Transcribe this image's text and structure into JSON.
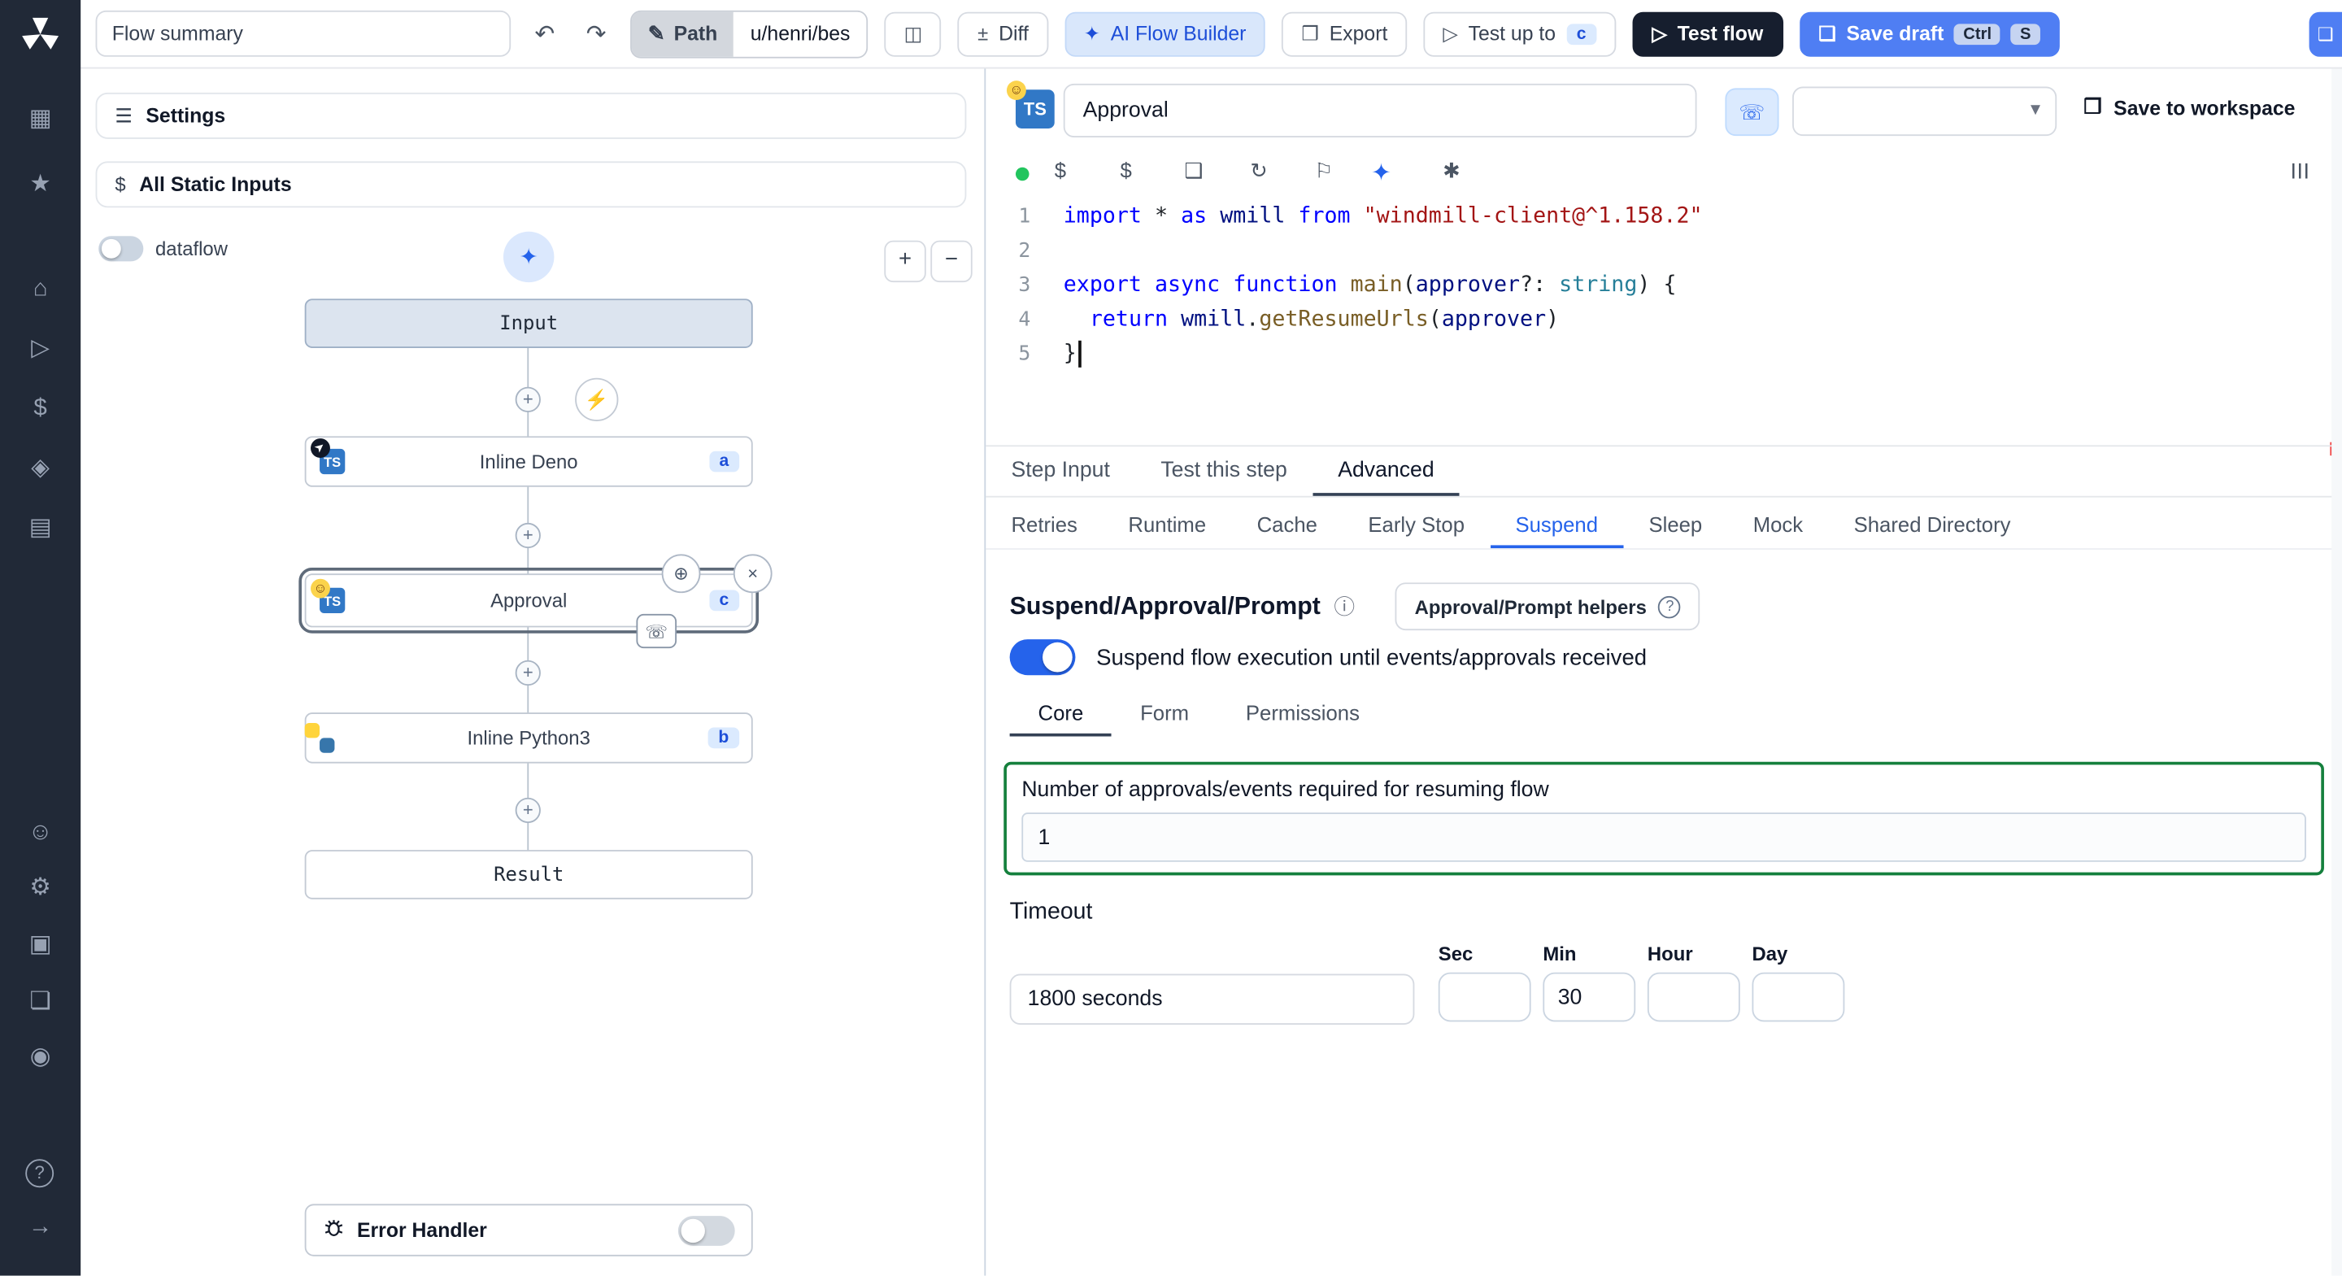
{
  "topbar": {
    "flow_summary_value": "Flow summary",
    "undo_icon": "↶",
    "redo_icon": "↷",
    "pencil_icon": "✎",
    "path_label": "Path",
    "path_value": "u/henri/bes",
    "book_icon": "◫",
    "diff_icon": "±",
    "diff_label": "Diff",
    "ai_icon": "✦",
    "ai_flow_builder_label": "AI Flow Builder",
    "export_icon": "❒",
    "export_label": "Export",
    "play_icon": "▷",
    "test_up_to_label": "Test up to",
    "test_up_to_badge": "c",
    "test_flow_label": "Test flow",
    "save_icon": "❑",
    "save_draft_label": "Save draft",
    "kbd_ctrl": "Ctrl",
    "kbd_s": "S",
    "partial_icon": "❑"
  },
  "sidebar": {
    "icons": [
      "▦",
      "★",
      "⌂",
      "▷",
      "$",
      "◈",
      "▤",
      "☺",
      "⚙",
      "▣",
      "❏",
      "◉",
      "?",
      "→"
    ]
  },
  "left_panel": {
    "settings_icon": "☰",
    "settings_label": "Settings",
    "dollar_icon": "$",
    "static_inputs_label": "All Static Inputs",
    "dataflow_label": "dataflow",
    "wand_icon": "✦",
    "zoom_in": "+",
    "zoom_out": "−",
    "error_handler_label": "Error Handler"
  },
  "graph": {
    "nodes": [
      {
        "label": "Input"
      },
      {
        "label": "Inline Deno",
        "badge": "a"
      },
      {
        "label": "Approval",
        "badge": "c"
      },
      {
        "label": "Inline Python3",
        "badge": "b"
      },
      {
        "label": "Result"
      }
    ],
    "ts_label": "TS",
    "smiley": "☺",
    "cursor_icon": "➤",
    "plus_icon": "+",
    "bolt_icon": "⚡",
    "crosshair_icon": "⊕",
    "close_icon": "×",
    "phone_icon": "☏"
  },
  "editor": {
    "title_value": "Approval",
    "chevron_icon": "▾",
    "box_icon": "❒",
    "save_to_workspace_label": "Save to workspace",
    "toolbar": {
      "dollar": "$",
      "cube": "❑",
      "refresh": "↻",
      "tag": "⚐",
      "wand": "✦",
      "sparkles": "✱",
      "outline": "☰"
    },
    "code": {
      "lines": [
        {
          "n": "1",
          "tokens": [
            [
              "kw",
              "import"
            ],
            [
              "pl",
              " * "
            ],
            [
              "kw",
              "as"
            ],
            [
              "vr",
              " wmill "
            ],
            [
              "kw",
              "from"
            ],
            [
              "pl",
              " "
            ],
            [
              "st",
              "\"windmill-client@^1.158.2\""
            ]
          ]
        },
        {
          "n": "2",
          "tokens": []
        },
        {
          "n": "3",
          "tokens": [
            [
              "kw",
              "export"
            ],
            [
              "pl",
              " "
            ],
            [
              "kw",
              "async"
            ],
            [
              "pl",
              " "
            ],
            [
              "kw",
              "function"
            ],
            [
              "pl",
              " "
            ],
            [
              "fn",
              "main"
            ],
            [
              "pl",
              "("
            ],
            [
              "vr",
              "approver"
            ],
            [
              "pl",
              "?: "
            ],
            [
              "ty",
              "string"
            ],
            [
              "pl",
              ") {"
            ]
          ]
        },
        {
          "n": "4",
          "tokens": [
            [
              "pl",
              "  "
            ],
            [
              "kw",
              "return"
            ],
            [
              "pl",
              " "
            ],
            [
              "vr",
              "wmill"
            ],
            [
              "pl",
              "."
            ],
            [
              "fn",
              "getResumeUrls"
            ],
            [
              "pl",
              "("
            ],
            [
              "vr",
              "approver"
            ],
            [
              "pl",
              ")"
            ]
          ]
        },
        {
          "n": "5",
          "tokens": [
            [
              "pl",
              "}"
            ]
          ]
        }
      ]
    }
  },
  "tabs": {
    "step": [
      {
        "label": "Step Input"
      },
      {
        "label": "Test this step"
      },
      {
        "label": "Advanced"
      }
    ],
    "advanced": [
      {
        "label": "Retries"
      },
      {
        "label": "Runtime"
      },
      {
        "label": "Cache"
      },
      {
        "label": "Early Stop"
      },
      {
        "label": "Suspend"
      },
      {
        "label": "Sleep"
      },
      {
        "label": "Mock"
      },
      {
        "label": "Shared Directory"
      }
    ],
    "suspend_sub": [
      {
        "label": "Core"
      },
      {
        "label": "Form"
      },
      {
        "label": "Permissions"
      }
    ]
  },
  "suspend": {
    "heading": "Suspend/Approval/Prompt",
    "info_icon": "ⓘ",
    "helpers_label": "Approval/Prompt helpers",
    "help_icon": "?",
    "toggle_label": "Suspend flow execution until events/approvals received",
    "approvals_label": "Number of approvals/events required for resuming flow",
    "approvals_value": "1",
    "timeout_label": "Timeout",
    "timeout_value": "1800 seconds",
    "sec_label": "Sec",
    "min_label": "Min",
    "min_value": "30",
    "hour_label": "Hour",
    "day_label": "Day"
  }
}
